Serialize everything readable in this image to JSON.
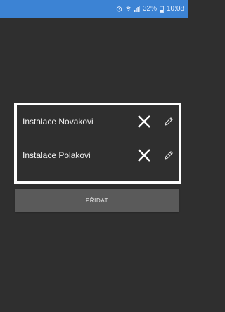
{
  "status_bar": {
    "alarm_icon": "alarm-icon",
    "wifi_icon": "wifi-icon",
    "signal_icon": "signal-icon",
    "battery_percent": "32%",
    "battery_icon": "battery-icon",
    "time": "10:08"
  },
  "list": {
    "items": [
      {
        "label": "Instalace Novakovi",
        "delete_icon": "close-icon",
        "edit_icon": "pencil-icon"
      },
      {
        "label": "Instalace Polakovi",
        "delete_icon": "close-icon",
        "edit_icon": "pencil-icon"
      }
    ]
  },
  "add_button": {
    "label": "PŘIDAT"
  },
  "colors": {
    "status_bar": "#3c83d4",
    "background": "#2f2f2f",
    "list_border": "#ffffff",
    "button": "#5a5a5a"
  }
}
